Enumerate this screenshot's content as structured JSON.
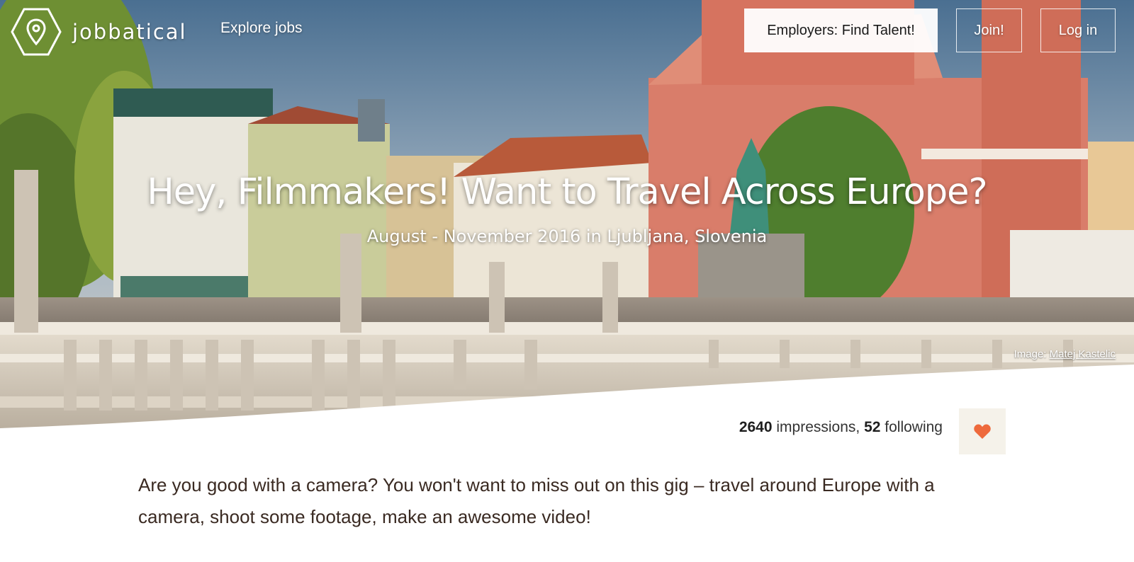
{
  "brand": {
    "name": "jobbatical",
    "logo_icon": "map-pin-hexagon-icon"
  },
  "nav": {
    "explore_label": "Explore jobs",
    "employers_label": "Employers: Find Talent!",
    "join_label": "Join!",
    "login_label": "Log in"
  },
  "hero": {
    "title": "Hey, Filmmakers! Want to Travel Across Europe?",
    "subtitle": "August - November 2016 in Ljubljana, Slovenia",
    "credit_prefix": "Image: ",
    "credit_author": "Matej Kastelic"
  },
  "stats": {
    "impressions_count": "2640",
    "impressions_label": " impressions, ",
    "following_count": "52",
    "following_label": " following",
    "follow_icon": "heart-icon"
  },
  "description": "Are you good with a camera? You won't want to miss out on this gig – travel around Europe with a camera, shoot some footage, make an awesome video!",
  "colors": {
    "accent_heart": "#ee6a3c",
    "text_dark": "#3a2a22",
    "follow_bg": "#f5f2ea"
  }
}
